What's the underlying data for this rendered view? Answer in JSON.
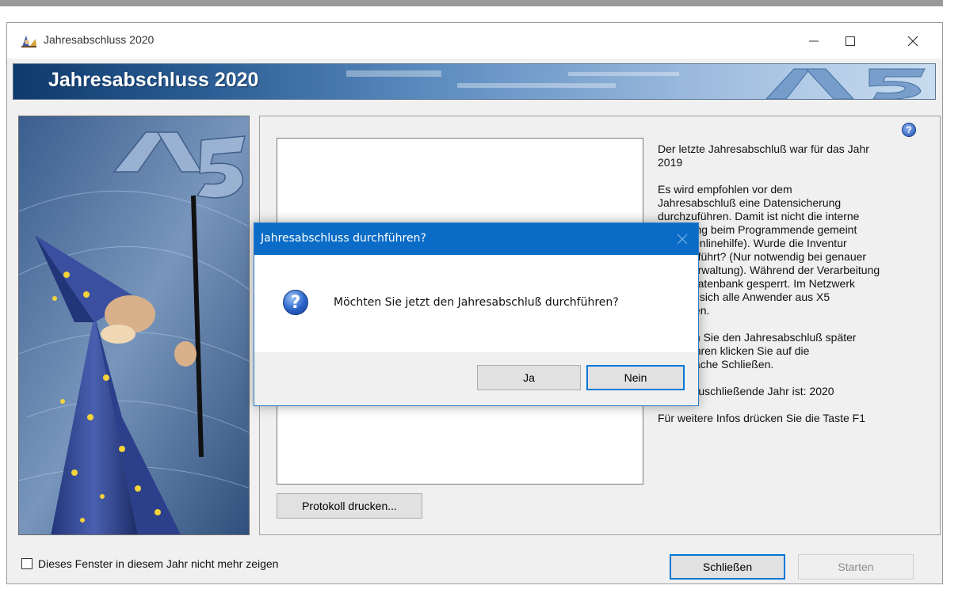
{
  "window": {
    "title": "Jahresabschluss 2020",
    "banner_title": "Jahresabschluss 2020"
  },
  "content": {
    "protocol_button": "Protokoll drucken...",
    "help_icon": "question-icon",
    "info_paragraphs": [
      "Der letzte Jahresabschluß war für das Jahr\n2019",
      "Es wird empfohlen vor dem\nJahresabschluß eine Datensicherung\ndurchzuführen. Damit ist nicht die interne\nSicherung beim Programmende gemeint\n(siehe Onlinehilfe). Wurde die Inventur\ndurchgeführt? (Nur notwendig bei genauer\nLagerverwaltung). Während der Verarbeitung\nist die Datenbank gesperrt. Im Netzwerk\nmüssen sich alle Anwender aus X5\nabmelden.",
      "Möchten Sie den Jahresabschluß später\ndurchführen klicken Sie auf die\nSchaltfläche Schließen.",
      "Das abzuschließende Jahr ist: 2020",
      "Für weitere Infos drücken Sie die Taste F1"
    ]
  },
  "footer": {
    "checkbox_label": "Dieses Fenster in diesem Jahr nicht mehr zeigen",
    "checkbox_checked": false,
    "close_button": "Schließen",
    "start_button": "Starten"
  },
  "dialog": {
    "title": "Jahresabschluss durchführen?",
    "message": "Möchten Sie jetzt den Jahresabschluß durchführen?",
    "yes_button": "Ja",
    "no_button": "Nein"
  },
  "colors": {
    "dialog_title_bg": "#0a6cc6",
    "banner_dark": "#0e3a6d",
    "button_focus": "#0078d7"
  }
}
